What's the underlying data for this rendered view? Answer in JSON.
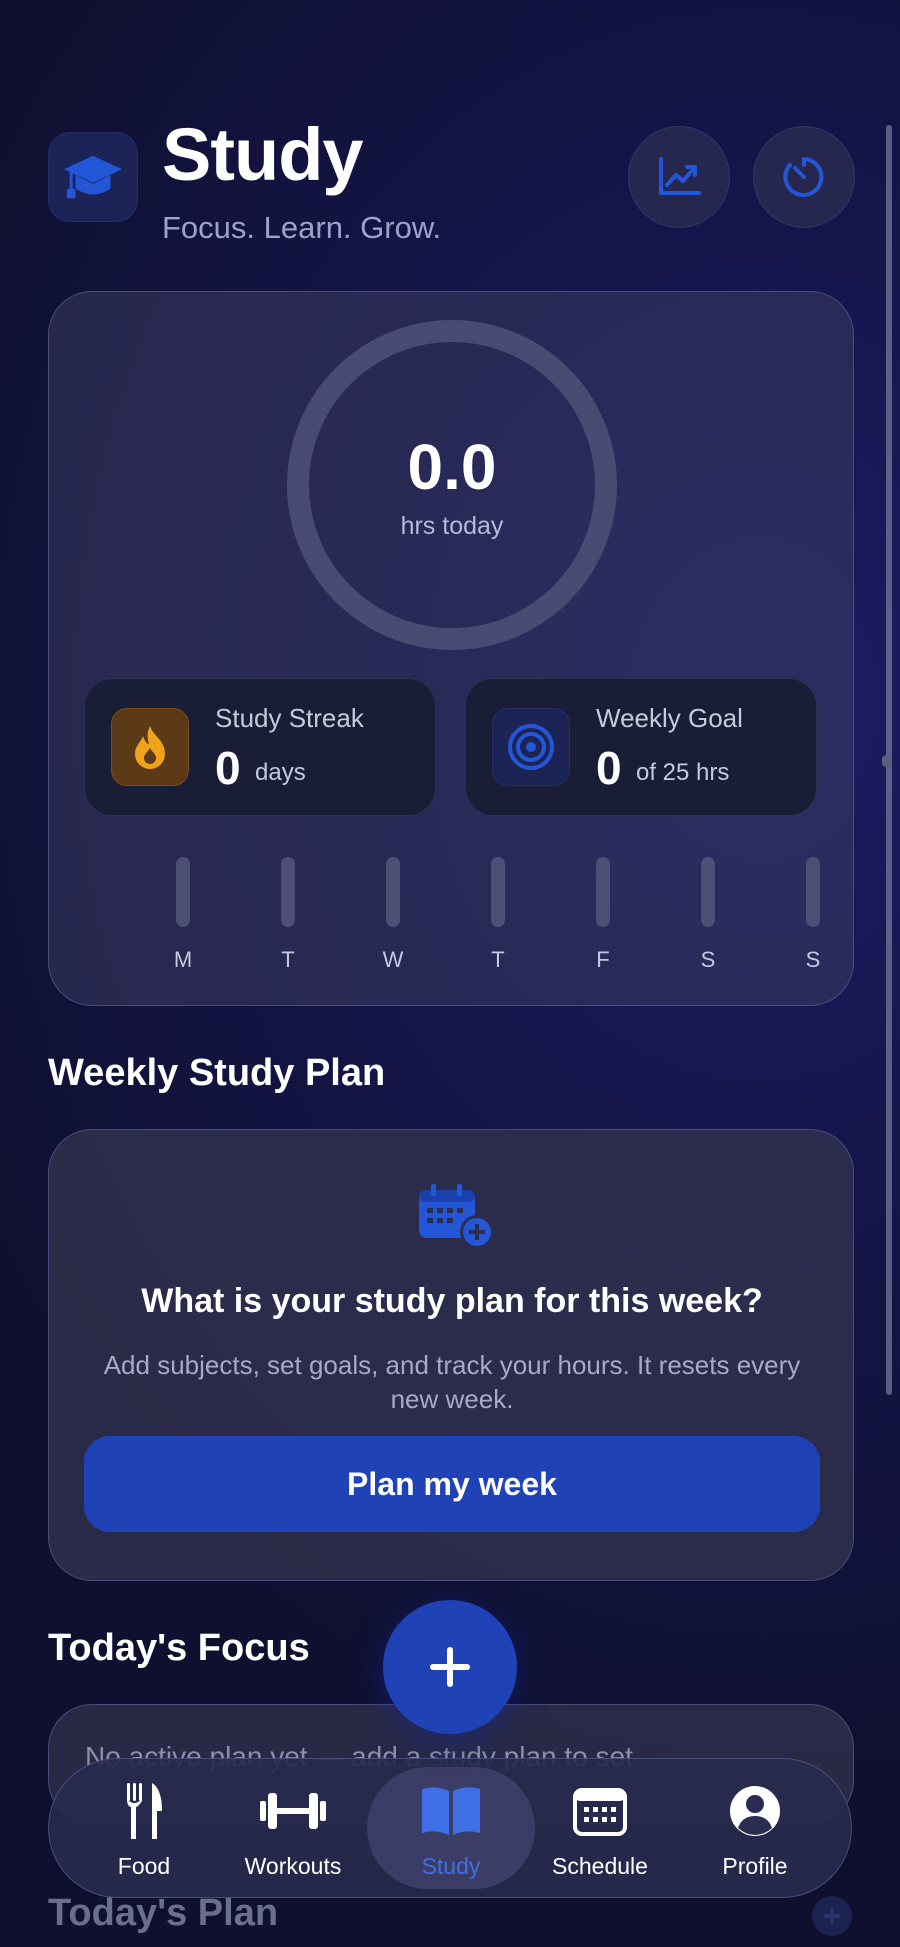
{
  "header": {
    "title": "Study",
    "subtitle": "Focus. Learn. Grow.",
    "app_icon": "graduation-cap-icon",
    "chart_button_icon": "trend-chart-icon",
    "timer_button_icon": "timer-icon"
  },
  "today": {
    "hours_value": "0.0",
    "hours_label": "hrs today",
    "progress": 0
  },
  "stats": {
    "streak": {
      "title": "Study Streak",
      "value": "0",
      "unit": "days",
      "icon": "flame-icon"
    },
    "goal": {
      "title": "Weekly Goal",
      "value": "0",
      "unit": "of 25 hrs",
      "icon": "target-icon"
    }
  },
  "week": {
    "days": [
      "M",
      "T",
      "W",
      "T",
      "F",
      "S",
      "S"
    ],
    "hours": [
      0,
      0,
      0,
      0,
      0,
      0,
      0
    ]
  },
  "plan": {
    "section_title": "Weekly Study Plan",
    "question": "What is your study plan for this week?",
    "description": "Add subjects, set goals, and track your hours. It resets every new week.",
    "button_label": "Plan my week",
    "icon": "calendar-add-icon"
  },
  "focus": {
    "section_title": "Today's Focus",
    "empty_text": "No active plan yet — add a study plan to set"
  },
  "todays_plan": {
    "section_title": "Today's Plan"
  },
  "fab": {
    "icon": "plus-icon"
  },
  "tabs": [
    {
      "label": "Food",
      "icon": "utensils-icon",
      "active": false
    },
    {
      "label": "Workouts",
      "icon": "dumbbell-icon",
      "active": false
    },
    {
      "label": "Study",
      "icon": "book-icon",
      "active": true
    },
    {
      "label": "Schedule",
      "icon": "calendar-icon",
      "active": false
    },
    {
      "label": "Profile",
      "icon": "user-circle-icon",
      "active": false
    }
  ],
  "colors": {
    "accent": "#1f43b6",
    "active_tab": "#3f6fe6",
    "streak_orange": "#f0a21a"
  }
}
